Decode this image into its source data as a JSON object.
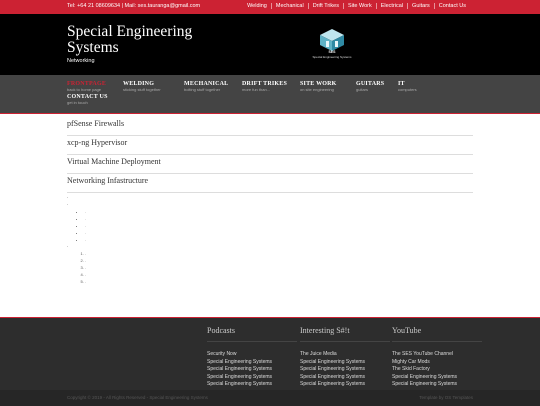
{
  "topbar": {
    "contact": "Tel: +64 21 08609634 | Mail: ses.tauranga@gmail.com",
    "links": [
      "Welding",
      "Mechanical",
      "Drift Trikes",
      "Site Work",
      "Electrical",
      "Guitars",
      "Contact Us"
    ]
  },
  "header": {
    "title": "Special Engineering Systems",
    "subtitle": "Networking",
    "logo_text": "SES",
    "logo_caption": "Special Engineering Systems"
  },
  "nav": [
    {
      "title": "FRONTPAGE",
      "sub": "back to home page",
      "active": true
    },
    {
      "title": "CONTACT US",
      "sub": "get in touch",
      "active": false
    },
    {
      "title": "WELDING",
      "sub": "sticking stuff together",
      "active": false
    },
    {
      "title": "MECHANICAL",
      "sub": "bolting stuff together",
      "active": false
    },
    {
      "title": "DRIFT TRIKES",
      "sub": "more fun than...",
      "active": false
    },
    {
      "title": "SITE WORK",
      "sub": "on site engineering",
      "active": false
    },
    {
      "title": "GUITARS",
      "sub": "guitars",
      "active": false
    },
    {
      "title": "IT",
      "sub": "computers",
      "active": false
    }
  ],
  "main": {
    "items": [
      "pfSense Firewalls",
      "xcp-ng Hypervisor",
      "Virtual Machine Deployment",
      "Networking Infastructure"
    ],
    "dots": [
      ".",
      "."
    ],
    "bullets": [
      ".",
      ".",
      ".",
      ".",
      "."
    ],
    "dot3": ".",
    "numbered": [
      ".",
      ".",
      ".",
      ".",
      "."
    ]
  },
  "footer": {
    "columns": [
      {
        "heading": "Podcasts",
        "links": [
          "Security Now",
          "Special Engineering Systems",
          "Special Engineering Systems",
          "Special Engineering Systems",
          "Special Engineering Systems"
        ]
      },
      {
        "heading": "Interesting S#!t",
        "links": [
          "The Juice Media",
          "Special Engineering Systems",
          "Special Engineering Systems",
          "Special Engineering Systems",
          "Special Engineering Systems"
        ]
      },
      {
        "heading": "YouTube",
        "links": [
          "The SES YouTube Channel",
          "Mighty Car Mods",
          "The Skid Factory",
          "Special Engineering Systems",
          "Special Engineering Systems"
        ]
      }
    ],
    "copyright": "Copyright © 2019 - All Rights Reserved - Special Engineering Systems",
    "credit": "Template by OS Templates"
  },
  "colors": {
    "accent": "#cc2233",
    "header_bg": "#000000",
    "nav_bg": "#444444",
    "footer_bg": "#2d2d2d"
  }
}
